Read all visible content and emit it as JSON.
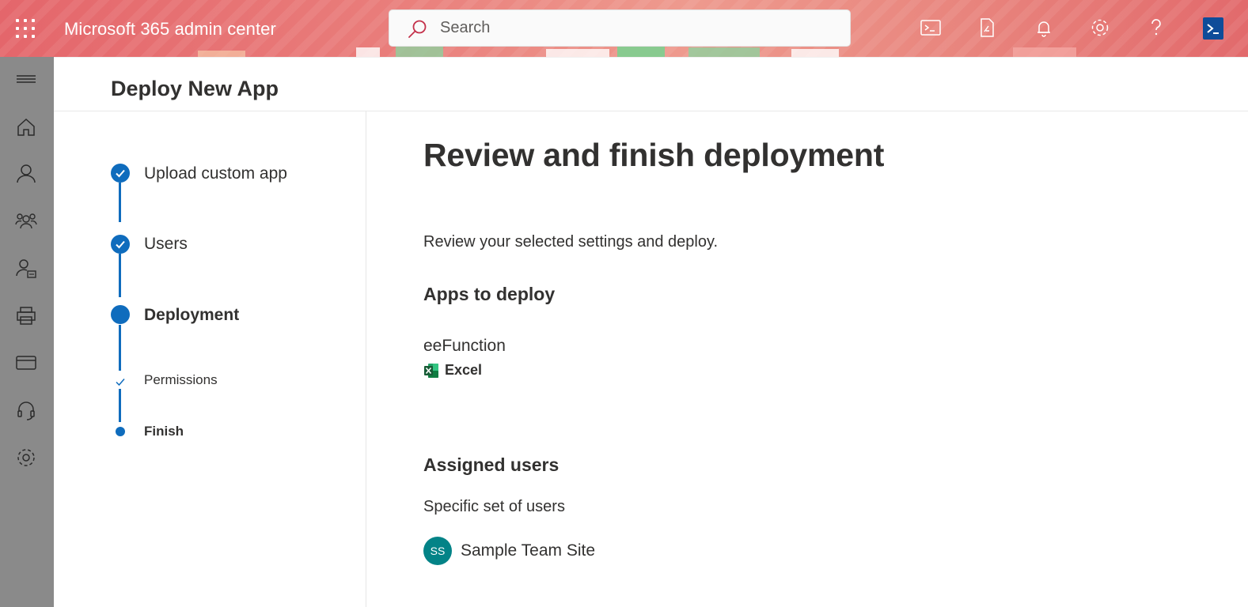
{
  "header": {
    "app_title": "Microsoft 365 admin center",
    "search_placeholder": "Search",
    "icons": [
      "terminal-icon",
      "document-icon",
      "bell-icon",
      "gear-icon",
      "help-icon",
      "powershell-icon"
    ]
  },
  "rail": {
    "items": [
      "menu-icon",
      "home-icon",
      "user-icon",
      "group-icon",
      "user-badge-icon",
      "printer-icon",
      "billing-card-icon",
      "headset-icon",
      "gear-icon"
    ]
  },
  "page": {
    "title": "Deploy New App"
  },
  "stepper": {
    "steps": [
      {
        "label": "Upload custom app",
        "state": "completed"
      },
      {
        "label": "Users",
        "state": "completed"
      },
      {
        "label": "Deployment",
        "state": "current"
      }
    ],
    "substeps": [
      {
        "label": "Permissions",
        "state": "completed"
      },
      {
        "label": "Finish",
        "state": "current"
      }
    ]
  },
  "main": {
    "title": "Review and finish deployment",
    "description": "Review your selected settings and deploy.",
    "apps_heading": "Apps to deploy",
    "app_name": "eeFunction",
    "app_host": "Excel",
    "users_heading": "Assigned users",
    "users_scope": "Specific set of users",
    "user_initials": "SS",
    "user_name": "Sample Team Site"
  },
  "colors": {
    "accent": "#0f6cbd",
    "avatar": "#038387",
    "rail": "#8a8a8a",
    "header": "#e97c7a"
  }
}
